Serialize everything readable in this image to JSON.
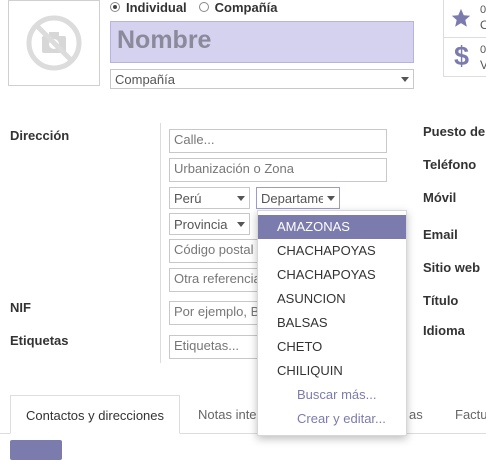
{
  "radio": {
    "individual": "Individual",
    "company": "Compañía"
  },
  "name_placeholder": "Nombre",
  "company_select": "Compañía",
  "side_stats": [
    {
      "value": "0",
      "label": "O",
      "icon": "star-icon",
      "color": "#7c7bad"
    },
    {
      "value": "0",
      "label": "V",
      "icon": "dollar-icon",
      "color": "#7c7bad"
    }
  ],
  "left_labels": {
    "address": "Dirección",
    "nif": "NIF",
    "tags": "Etiquetas"
  },
  "address": {
    "street": "Calle...",
    "urbanization": "Urbanización o Zona",
    "country": "Perú",
    "department": "Departame",
    "province": "Provincia",
    "postal": "Código postal",
    "other_ref": "Otra referencia"
  },
  "nif_placeholder": "Por ejemplo, B",
  "tags_placeholder": "Etiquetas...",
  "right_labels": {
    "job": "Puesto de",
    "phone": "Teléfono",
    "mobile": "Móvil",
    "email": "Email",
    "website": "Sitio web",
    "title": "Título",
    "language": "Idioma"
  },
  "dropdown": {
    "items": [
      "AMAZONAS",
      "CHACHAPOYAS",
      "CHACHAPOYAS",
      "ASUNCION",
      "BALSAS",
      "CHETO",
      "CHILIQUIN"
    ],
    "search_more": "Buscar más...",
    "create_edit": "Crear y editar..."
  },
  "tabs": {
    "contacts": "Contactos y direcciones",
    "notes": "Notas inte",
    "sales": "as",
    "invoicing": "Factu"
  },
  "colors": {
    "accent": "#7c7bad",
    "name_bg": "#d5d2f0"
  }
}
